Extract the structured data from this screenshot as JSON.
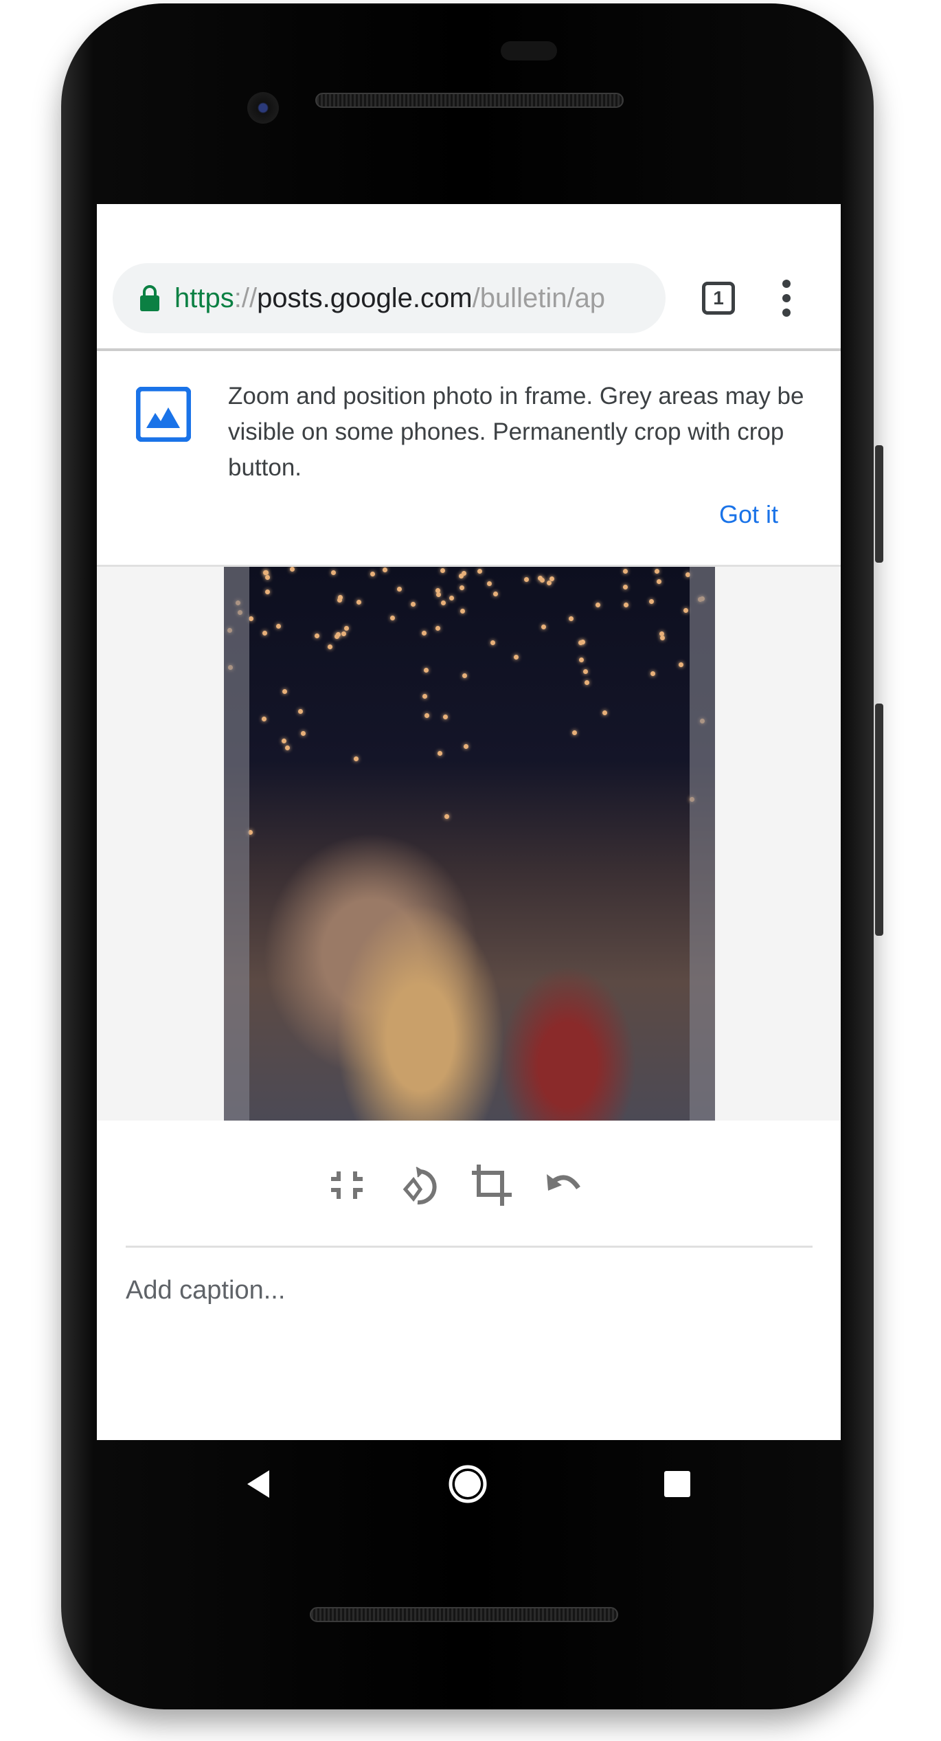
{
  "browser": {
    "url_scheme": "https",
    "url_sep": "://",
    "url_host": "posts.google.com",
    "url_path": "/bulletin/ap",
    "tab_count": "1",
    "scheme_color": "#0b8043"
  },
  "banner": {
    "icon": "image-icon",
    "message": "Zoom and position photo in frame. Grey areas may be visible on some phones. Permanently crop with crop button.",
    "dismiss_label": "Got it",
    "accent": "#1a73e8"
  },
  "editor": {
    "tools": [
      "fit-icon",
      "rotate-icon",
      "crop-icon",
      "undo-icon"
    ],
    "caption_placeholder": "Add caption..."
  },
  "navbar": {
    "buttons": [
      "back",
      "home",
      "recents"
    ]
  }
}
